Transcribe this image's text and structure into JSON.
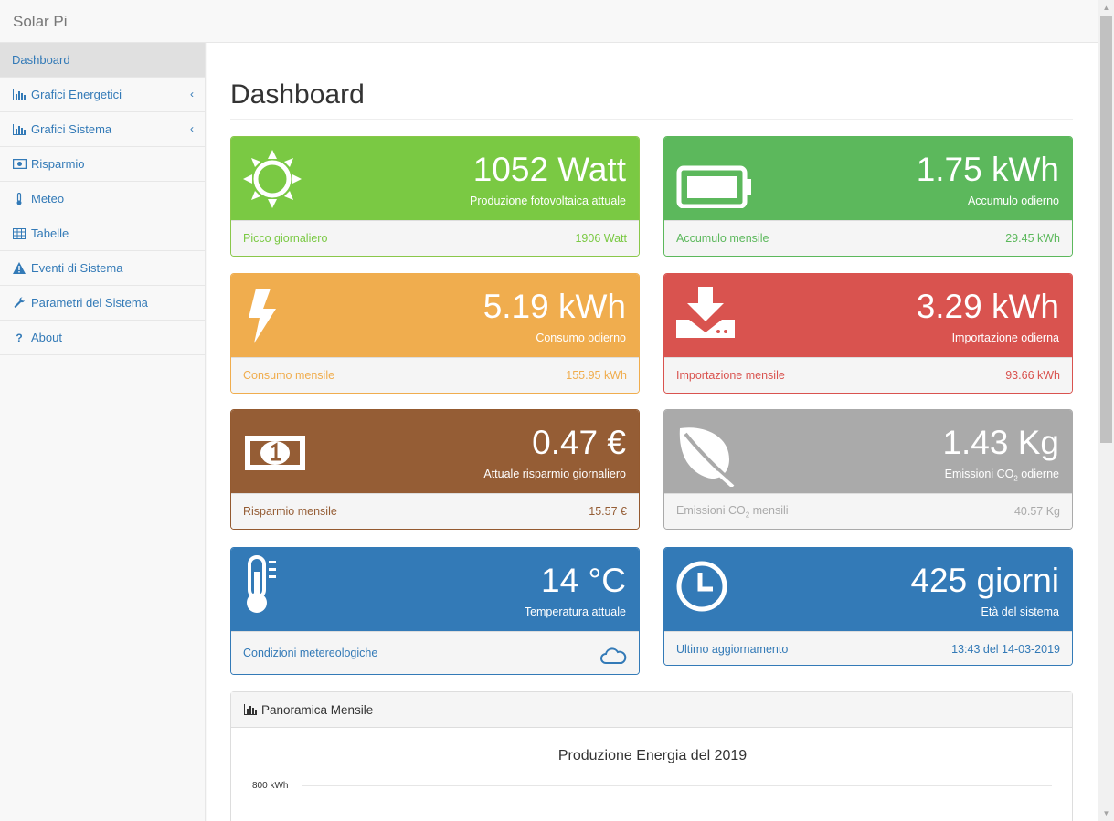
{
  "app": {
    "brand": "Solar Pi"
  },
  "sidebar": {
    "items": [
      {
        "label": "Dashboard",
        "icon": "none"
      },
      {
        "label": "Grafici Energetici",
        "icon": "bar-chart-icon"
      },
      {
        "label": "Grafici Sistema",
        "icon": "bar-chart-icon"
      },
      {
        "label": "Risparmio",
        "icon": "money-icon"
      },
      {
        "label": "Meteo",
        "icon": "thermometer-icon"
      },
      {
        "label": "Tabelle",
        "icon": "table-icon"
      },
      {
        "label": "Eventi di Sistema",
        "icon": "warning-icon"
      },
      {
        "label": "Parametri del Sistema",
        "icon": "wrench-icon"
      },
      {
        "label": "About",
        "icon": "question-icon"
      }
    ]
  },
  "page": {
    "title": "Dashboard"
  },
  "panels": {
    "production": {
      "value": "1052 Watt",
      "label": "Produzione fotovoltaica attuale",
      "foot_label": "Picco giornaliero",
      "foot_value": "1906 Watt"
    },
    "storage": {
      "value": "1.75 kWh",
      "label": "Accumulo odierno",
      "foot_label": "Accumulo mensile",
      "foot_value": "29.45 kWh"
    },
    "consumption": {
      "value": "5.19 kWh",
      "label": "Consumo odierno",
      "foot_label": "Consumo mensile",
      "foot_value": "155.95 kWh"
    },
    "import": {
      "value": "3.29 kWh",
      "label": "Importazione odierna",
      "foot_label": "Importazione mensile",
      "foot_value": "93.66 kWh"
    },
    "savings": {
      "value": "0.47 €",
      "label": "Attuale risparmio giornaliero",
      "foot_label": "Risparmio mensile",
      "foot_value": "15.57 €"
    },
    "emissions": {
      "value": "1.43 Kg",
      "label_pre": "Emissioni CO",
      "label_sub": "2",
      "label_post": " odierne",
      "foot_pre": "Emissioni CO",
      "foot_sub": "2",
      "foot_post": " mensili",
      "foot_value": "40.57 Kg"
    },
    "weather": {
      "value": "14 °C",
      "label": "Temperatura attuale",
      "foot_label": "Condizioni metereologiche"
    },
    "age": {
      "value": "425 giorni",
      "label": "Età del sistema",
      "foot_label": "Ultimo aggiornamento",
      "foot_value": "13:43 del 14-03-2019"
    }
  },
  "monthly": {
    "header": "Panoramica Mensile",
    "chart_title": "Produzione Energia del 2019",
    "y_tick": "800 kWh"
  },
  "colors": {
    "production": "#7ac943",
    "storage": "#5cb85c",
    "consumption": "#f0ad4e",
    "import": "#d9534f",
    "savings": "#955d35",
    "emissions": "#aaaaaa",
    "info": "#337ab7"
  }
}
